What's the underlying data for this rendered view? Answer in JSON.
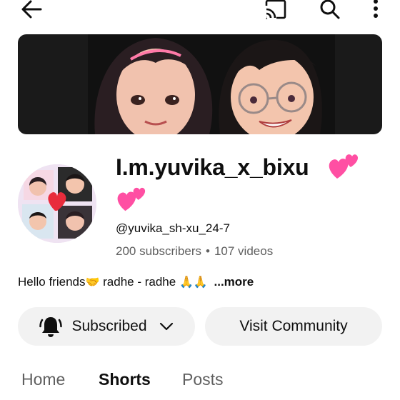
{
  "header": {
    "icons": [
      "back-arrow-icon",
      "cast-icon",
      "search-icon",
      "more-vertical-icon"
    ]
  },
  "channel": {
    "name": "I.m.yuvika_x_bixu",
    "handle": "@yuvika_sh-xu_24-7",
    "subscribers": "200 subscribers",
    "separator": "•",
    "videos": "107 videos",
    "description_text": "Hello friends",
    "description_emoji1": "🤝",
    "description_text2": " radhe - radhe ",
    "description_emoji2": "🙏🙏",
    "description_more": "...more"
  },
  "actions": {
    "subscribed_label": "Subscribed",
    "community_label": "Visit Community"
  },
  "tabs": [
    {
      "label": "Home",
      "active": false
    },
    {
      "label": "Shorts",
      "active": true
    },
    {
      "label": "Posts",
      "active": false
    }
  ],
  "colors": {
    "heart": "#ff4fa3",
    "button_bg": "#f2f2f2",
    "secondary_text": "#606060"
  }
}
